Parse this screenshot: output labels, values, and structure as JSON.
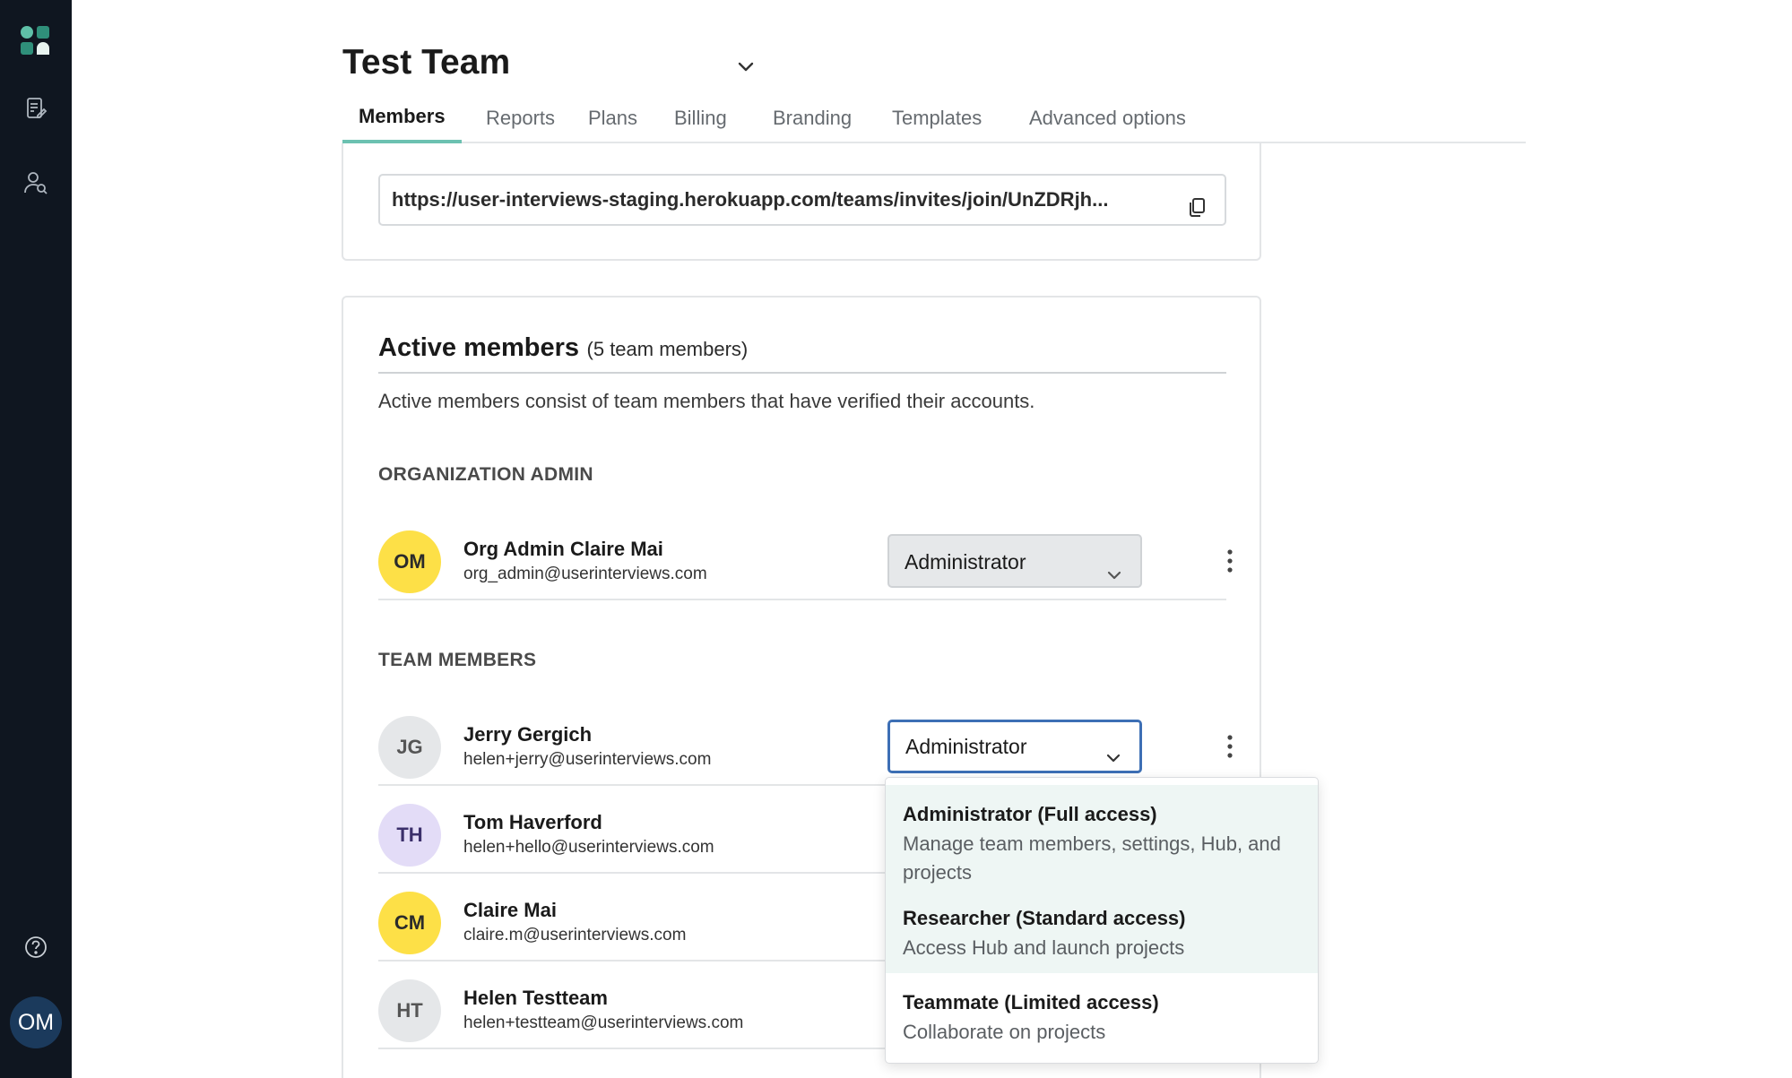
{
  "sidebar": {
    "avatar_initials": "OM",
    "icons": [
      "logo-icon",
      "projects-icon",
      "people-search-icon",
      "help-icon"
    ]
  },
  "header": {
    "team_name": "Test Team",
    "tabs": [
      {
        "label": "Members",
        "active": true
      },
      {
        "label": "Reports",
        "active": false
      },
      {
        "label": "Plans",
        "active": false
      },
      {
        "label": "Billing",
        "active": false
      },
      {
        "label": "Branding",
        "active": false
      },
      {
        "label": "Templates",
        "active": false
      },
      {
        "label": "Advanced options",
        "active": false
      }
    ]
  },
  "invite": {
    "link": "https://user-interviews-staging.herokuapp.com/teams/invites/join/UnZDRjh..."
  },
  "active_members": {
    "title": "Active members",
    "count": "(5 team members)",
    "description": "Active members consist of team members that have verified their accounts.",
    "org_admin_label": "ORGANIZATION ADMIN",
    "team_members_label": "TEAM MEMBERS",
    "org_admin": {
      "initials": "OM",
      "name": "Org Admin Claire Mai",
      "email": "org_admin@userinterviews.com",
      "role": "Administrator",
      "avatar_color": "#fde047"
    },
    "members": [
      {
        "initials": "JG",
        "name": "Jerry Gergich",
        "email": "helen+jerry@userinterviews.com",
        "role": "Administrator",
        "avatar_color": "#e5e7e9"
      },
      {
        "initials": "TH",
        "name": "Tom Haverford",
        "email": "helen+hello@userinterviews.com",
        "avatar_color": "#e3dcf7"
      },
      {
        "initials": "CM",
        "name": "Claire Mai",
        "email": "claire.m@userinterviews.com",
        "avatar_color": "#fde047"
      },
      {
        "initials": "HT",
        "name": "Helen Testteam",
        "email": "helen+testteam@userinterviews.com",
        "avatar_color": "#e5e7e9"
      }
    ]
  },
  "role_dropdown": {
    "options": [
      {
        "title": "Administrator (Full access)",
        "description": "Manage team members, settings, Hub, and projects",
        "highlighted": true
      },
      {
        "title": "Researcher (Standard access)",
        "description": "Access Hub and launch projects",
        "highlighted": true
      },
      {
        "title": "Teammate (Limited access)",
        "description": "Collaborate on projects",
        "highlighted": false
      }
    ]
  },
  "colors": {
    "sidebar_bg": "#0f1620",
    "tab_accent": "#6cc1b1",
    "focus_border": "#3d6fb5",
    "highlight_bg": "#eef6f4"
  }
}
